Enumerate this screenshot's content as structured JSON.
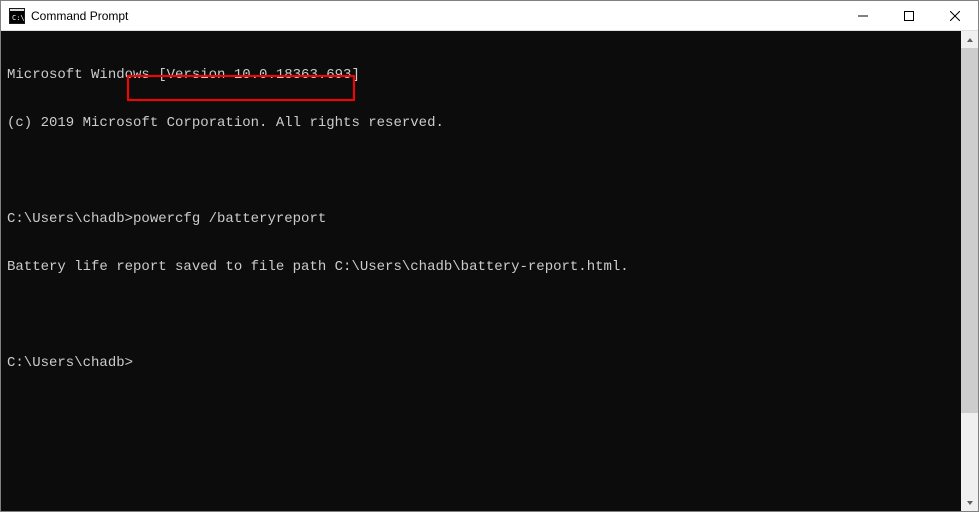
{
  "titlebar": {
    "title": "Command Prompt",
    "icon_name": "cmd-icon"
  },
  "terminal": {
    "lines": [
      "Microsoft Windows [Version 10.0.18363.693]",
      "(c) 2019 Microsoft Corporation. All rights reserved.",
      "",
      "C:\\Users\\chadb>powercfg /batteryreport",
      "Battery life report saved to file path C:\\Users\\chadb\\battery-report.html.",
      "",
      "C:\\Users\\chadb>"
    ]
  }
}
